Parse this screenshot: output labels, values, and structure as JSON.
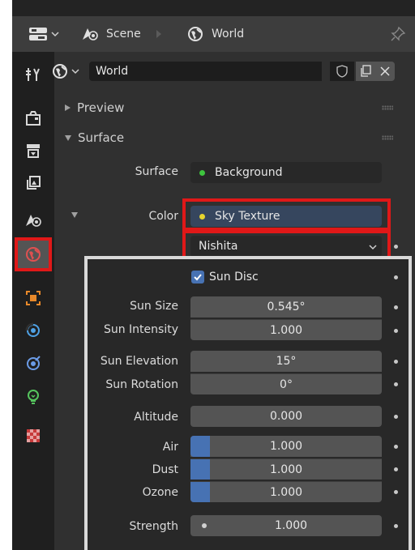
{
  "header": {
    "scene_label": "Scene",
    "world_label": "World"
  },
  "datablock": {
    "name": "World"
  },
  "panels": {
    "preview": "Preview",
    "surface": "Surface"
  },
  "surface": {
    "surface_label": "Surface",
    "surface_value": "Background",
    "color_label": "Color",
    "color_value": "Sky Texture",
    "sky_type": "Nishita"
  },
  "sky": {
    "sun_disc_label": "Sun Disc",
    "sun_disc_checked": true,
    "rows": [
      {
        "label": "Sun Size",
        "value": "0.545°"
      },
      {
        "label": "Sun Intensity",
        "value": "1.000"
      },
      {
        "label": "Sun Elevation",
        "value": "15°"
      },
      {
        "label": "Sun Rotation",
        "value": "0°"
      },
      {
        "label": "Altitude",
        "value": "0.000"
      },
      {
        "label": "Air",
        "value": "1.000",
        "fill": 0.1
      },
      {
        "label": "Dust",
        "value": "1.000",
        "fill": 0.1
      },
      {
        "label": "Ozone",
        "value": "1.000",
        "fill": 0.1
      },
      {
        "label": "Strength",
        "value": "1.000"
      }
    ]
  },
  "colors": {
    "highlight": "#e01818",
    "accent": "#4772b3",
    "socket_green": "#3ec43e",
    "socket_yellow": "#e6d52e"
  }
}
